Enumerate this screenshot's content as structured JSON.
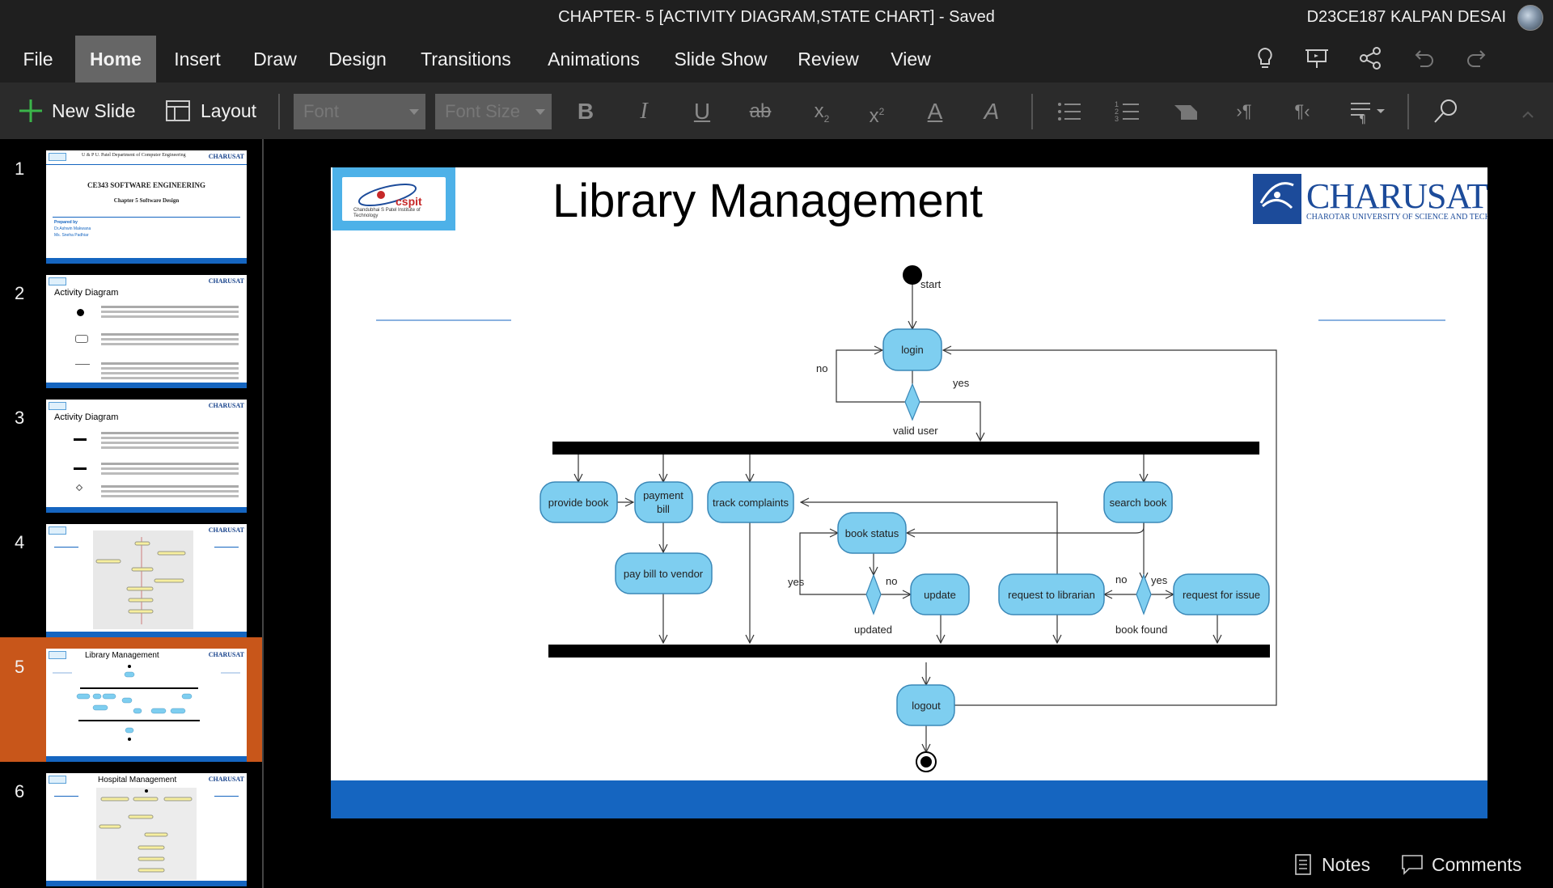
{
  "window": {
    "doc_title": "CHAPTER- 5 [ACTIVITY DIAGRAM,STATE CHART] - Saved",
    "user_name": "D23CE187 KALPAN DESAI"
  },
  "ribbon": {
    "tabs": [
      "File",
      "Home",
      "Insert",
      "Draw",
      "Design",
      "Transitions",
      "Animations",
      "Slide Show",
      "Review",
      "View"
    ],
    "active_tab": "Home",
    "icons": [
      "lightbulb-icon",
      "present-icon",
      "share-icon",
      "undo-icon",
      "redo-icon"
    ]
  },
  "toolbar": {
    "new_slide": "New Slide",
    "layout": "Layout",
    "font_placeholder": "Font",
    "font_size_placeholder": "Font Size"
  },
  "slides": [
    {
      "num": "1",
      "heading": "",
      "lines": [
        "U & P U. Patel Department of Computer Engineering",
        "CE343 SOFTWARE ENGINEERING",
        "Chapter 5 Software Design",
        "Prepared by",
        "Dr.Ashwin Makwana",
        "Ms. Sneha Padhiar"
      ]
    },
    {
      "num": "2",
      "heading": "Activity Diagram",
      "lines": []
    },
    {
      "num": "3",
      "heading": "Activity Diagram",
      "lines": []
    },
    {
      "num": "4",
      "heading": "",
      "lines": []
    },
    {
      "num": "5",
      "heading": "Library Management",
      "lines": []
    },
    {
      "num": "6",
      "heading": "Hospital Management",
      "lines": []
    }
  ],
  "selected_slide": "5",
  "slide": {
    "title": "Library Management",
    "cspit_text": "cspit",
    "cspit_sub": "Chandubhai S Patel Institute of Technology",
    "charusat_word": "CHARUSAT",
    "charusat_sub": "CHAROTAR UNIVERSITY OF SCIENCE AND TECHNOLOGY"
  },
  "diagram": {
    "start": "start",
    "login": "login",
    "no1": "no",
    "yes1": "yes",
    "valid_user": "valid user",
    "provide_book": "provide book",
    "payment_bill": "payment bill",
    "track_complaints": "track complaints",
    "search_book": "search book",
    "book_status": "book status",
    "pay_bill_to_vendor": "pay bill to vendor",
    "yes2": "yes",
    "no2": "no",
    "update": "update",
    "updated": "updated",
    "request_to_librarian": "request to librarian",
    "no3": "no",
    "yes3": "yes",
    "request_for_issue": "request for issue",
    "book_found": "book found",
    "logout": "logout"
  },
  "footer": {
    "notes": "Notes",
    "comments": "Comments"
  },
  "colors": {
    "active_tab": "#666666",
    "selected_slide": "#c8561a",
    "slide_bar": "#1565c0",
    "activity_fill": "#7ecef0",
    "activity_stroke": "#3a88b8"
  }
}
